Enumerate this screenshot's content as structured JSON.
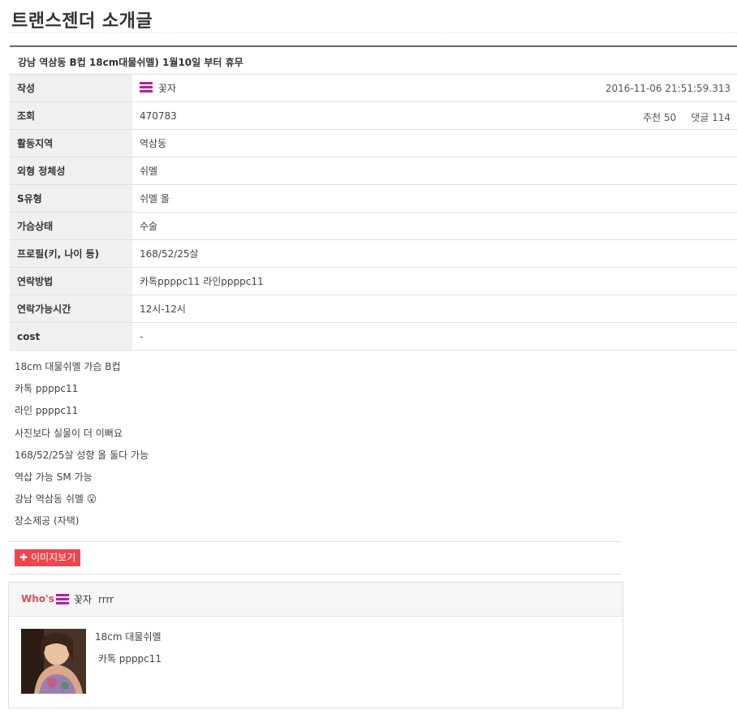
{
  "page_title": "트랜스젠더 소개글",
  "subject": "강남 역삼동 B컵 18cm대물쉬멜) 1월10일 부터 휴무",
  "info": {
    "author_label": "작성",
    "author_name": "꽃자",
    "datetime": "2016-11-06 21:51:59.313",
    "views_label": "조회",
    "views": "470783",
    "recommend": "추천 50",
    "comments": "댓글 114",
    "rows": [
      {
        "label": "활동지역",
        "value": "역삼동"
      },
      {
        "label": "외형 정체성",
        "value": "쉬멜"
      },
      {
        "label": "S유형",
        "value": "쉬멜 올"
      },
      {
        "label": "가슴상태",
        "value": "수술"
      },
      {
        "label": "프로필(키, 나이 등)",
        "value": "168/52/25살"
      },
      {
        "label": "연락방법",
        "value": "카톡ppppc11 라인ppppc11"
      },
      {
        "label": "연락가능시간",
        "value": "12시-12시"
      },
      {
        "label": "cost",
        "value": "-"
      }
    ]
  },
  "content_lines": [
    "18cm 대물쉬멜 가슴 B컵",
    "카톡 ppppc11",
    "라인 ppppc11",
    "사진보다 실물이 더 이뻐요",
    "168/52/25살 성향 올 둘다 가능",
    "역삽 가능 SM 가능",
    "강남 역삼동 쉬멜 😮",
    "장소제공 (자택)"
  ],
  "image_button": {
    "icon": "plus-icon",
    "label": "이미지보기"
  },
  "whos": {
    "label": "Who's",
    "nick": "꽃자",
    "extra": "rrrr",
    "line1": "18cm 대물쉬멜",
    "line2": " 카톡 ppppc11"
  },
  "colors": {
    "accent": "#f0444f",
    "member_icon": "#b4239b",
    "header_bg": "#f0f0f0"
  }
}
